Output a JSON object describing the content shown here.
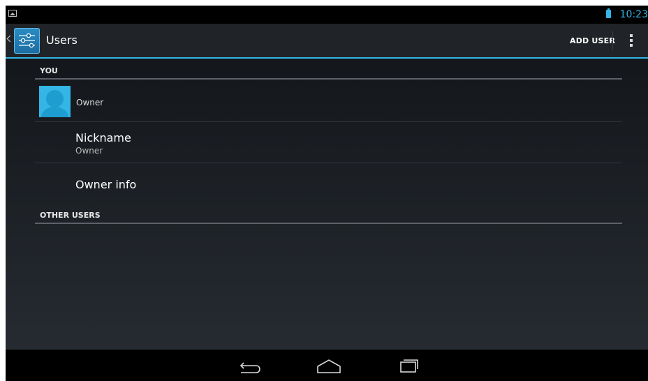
{
  "status_bar": {
    "time": "10:23",
    "icons": [
      "picture-notification-icon",
      "battery-icon"
    ]
  },
  "action_bar": {
    "title": "Users",
    "add_user_label": "ADD USER",
    "icons": [
      "up-caret-icon",
      "settings-sliders-icon",
      "overflow-menu-icon"
    ]
  },
  "sections": {
    "you": {
      "header": "YOU",
      "owner": {
        "name": "Owner",
        "avatar_icon": "user-avatar-icon"
      },
      "nickname": {
        "title": "Nickname",
        "summary": "Owner"
      },
      "owner_info": {
        "title": "Owner info"
      }
    },
    "other_users": {
      "header": "OTHER USERS"
    }
  },
  "nav_bar": {
    "icons": [
      "back-icon",
      "home-icon",
      "recent-apps-icon"
    ]
  },
  "colors": {
    "accent": "#33b5e5",
    "action_bar_bg": "#202327",
    "text_primary": "#ffffff",
    "text_secondary": "#b8b8b8"
  }
}
